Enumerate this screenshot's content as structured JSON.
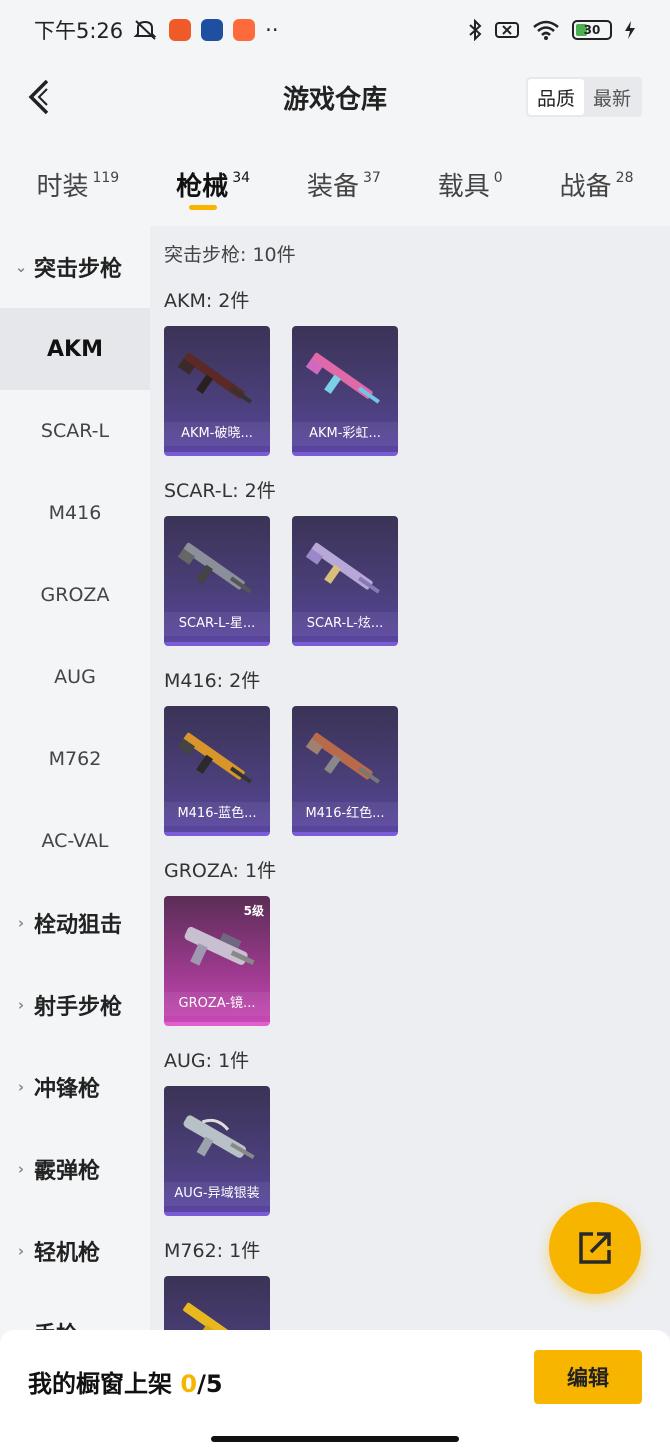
{
  "status_bar": {
    "time": "下午5:26",
    "dots": "··",
    "battery": "30"
  },
  "header": {
    "title": "游戏仓库",
    "sort_options": [
      "品质",
      "最新"
    ]
  },
  "tabs": [
    {
      "label": "时装",
      "count": "119"
    },
    {
      "label": "枪械",
      "count": "34"
    },
    {
      "label": "装备",
      "count": "37"
    },
    {
      "label": "载具",
      "count": "0"
    },
    {
      "label": "战备",
      "count": "28"
    }
  ],
  "sidebar": {
    "expanded_category": "突击步枪",
    "sub_items": [
      "AKM",
      "SCAR-L",
      "M416",
      "GROZA",
      "AUG",
      "M762",
      "AC-VAL"
    ],
    "categories": [
      "栓动狙击",
      "射手步枪",
      "冲锋枪",
      "霰弹枪",
      "轻机枪",
      "手枪"
    ]
  },
  "content": {
    "section_title": "突击步枪: 10件",
    "groups": [
      {
        "title": "AKM: 2件",
        "items": [
          {
            "name": "AKM-破晓..."
          },
          {
            "name": "AKM-彩虹..."
          }
        ]
      },
      {
        "title": "SCAR-L: 2件",
        "items": [
          {
            "name": "SCAR-L-星..."
          },
          {
            "name": "SCAR-L-炫..."
          }
        ]
      },
      {
        "title": "M416: 2件",
        "items": [
          {
            "name": "M416-蓝色..."
          },
          {
            "name": "M416-红色..."
          }
        ]
      },
      {
        "title": "GROZA: 1件",
        "items": [
          {
            "name": "GROZA-镜...",
            "level": "5级"
          }
        ]
      },
      {
        "title": "AUG: 1件",
        "items": [
          {
            "name": "AUG-异域银装"
          }
        ]
      },
      {
        "title": "M762: 1件",
        "items": [
          {
            "name": ""
          }
        ]
      }
    ]
  },
  "bottom_bar": {
    "shelf_label": "我的橱窗上架",
    "shelf_current": "0",
    "shelf_total": "/5",
    "edit_label": "编辑"
  },
  "colors": {
    "accent": "#f7b500",
    "card_purple": "#4b3f7a",
    "card_pink": "#9c3a8e"
  }
}
